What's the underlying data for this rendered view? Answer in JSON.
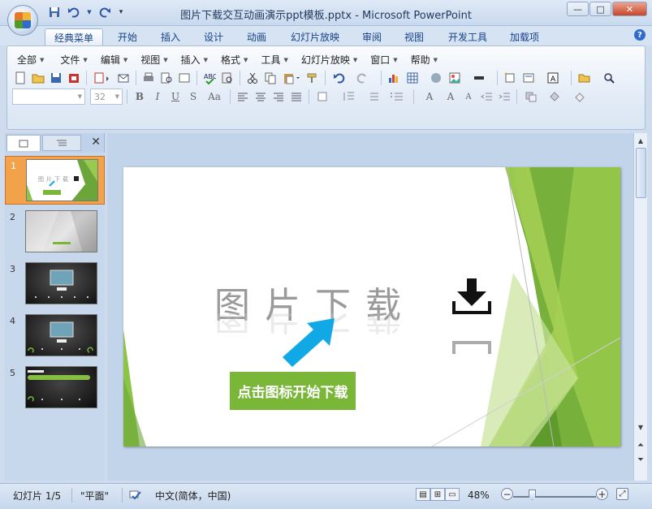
{
  "window": {
    "title": "图片下载交互动画演示ppt模板.pptx - Microsoft PowerPoint",
    "controls": {
      "minimize": "—",
      "maximize": "□",
      "close": "✕"
    }
  },
  "qat": {
    "save_icon": "save-icon",
    "undo_icon": "undo-icon",
    "redo_icon": "redo-icon",
    "customize_icon": "qat-dropdown-icon"
  },
  "ribbon_tabs": [
    {
      "label": "经典菜单",
      "active": true
    },
    {
      "label": "开始"
    },
    {
      "label": "插入"
    },
    {
      "label": "设计"
    },
    {
      "label": "动画"
    },
    {
      "label": "幻灯片放映"
    },
    {
      "label": "审阅"
    },
    {
      "label": "视图"
    },
    {
      "label": "开发工具"
    },
    {
      "label": "加载项"
    }
  ],
  "menus": [
    "全部",
    "文件",
    "编辑",
    "视图",
    "插入",
    "格式",
    "工具",
    "幻灯片放映",
    "窗口",
    "帮助"
  ],
  "format": {
    "font_size": "32"
  },
  "panel": {
    "outline_tab_icon": "outline-icon",
    "slides_tab_icon": "slides-icon",
    "close": "✕"
  },
  "slides": [
    {
      "number": "1",
      "selected": true
    },
    {
      "number": "2"
    },
    {
      "number": "3"
    },
    {
      "number": "4"
    },
    {
      "number": "5"
    }
  ],
  "slide": {
    "title": "图片下载",
    "cta": "点击图标开始下载",
    "colors": {
      "green": "#7ab739",
      "dark_green": "#5f9a2c",
      "light_green": "#a6d056",
      "arrow_blue": "#11a8e6"
    }
  },
  "status": {
    "slide_indicator": "幻灯片 1/5",
    "theme": "\"平面\"",
    "language": "中文(简体，中国)",
    "zoom": "48%"
  }
}
